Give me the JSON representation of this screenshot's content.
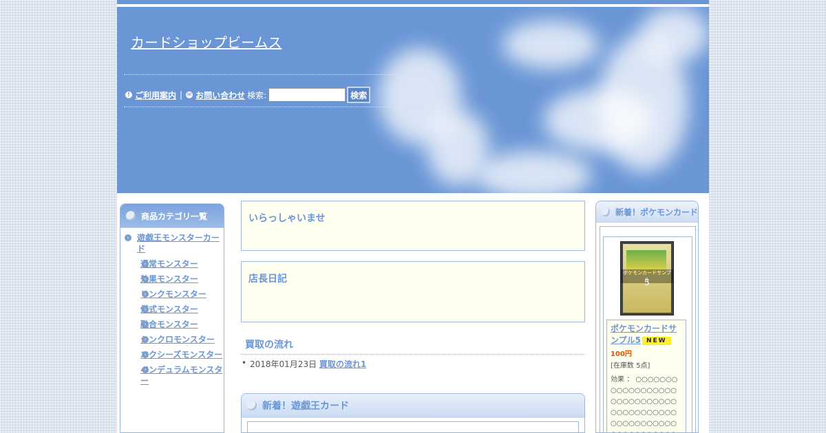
{
  "site_title": "カードショップビームス",
  "nav": {
    "guide_icon": "info-icon",
    "guide_label": "ご利用案内",
    "separator": "|",
    "contact_icon": "mail-icon",
    "contact_label": "お問い合わせ",
    "search_label": "検索:",
    "search_value": "",
    "search_button": "検索"
  },
  "left_sidebar": {
    "title": "商品カテゴリ一覧",
    "categories": [
      {
        "label": "遊戯王モンスターカード",
        "level": 1
      },
      {
        "label": "通常モンスター",
        "level": 2
      },
      {
        "label": "効果モンスター",
        "level": 2
      },
      {
        "label": "リンクモンスター",
        "level": 2
      },
      {
        "label": "儀式モンスター",
        "level": 2
      },
      {
        "label": "融合モンスター",
        "level": 2
      },
      {
        "label": "シンクロモンスター",
        "level": 2
      },
      {
        "label": "エクシーズモンスター",
        "level": 2
      },
      {
        "label": "ペンデュラムモンスター",
        "level": 2
      }
    ]
  },
  "main": {
    "welcome_title": "いらっしゃいませ",
    "diary_title": "店長日記",
    "flow_title": "買取の流れ",
    "flow_date": "2018年01月23日",
    "flow_link": "買取の流れ1",
    "yugioh_title": "新着！遊戯王カード"
  },
  "right_sidebar": {
    "title": "新着！ポケモンカード",
    "product": {
      "image_overlay": "ポケモンカードサンプル",
      "image_number": "5",
      "name": "ポケモンカードサンプル5",
      "badge": "NEW",
      "price": "100円",
      "stock": "[在庫数 5点]",
      "effect": "効果 ： ○○○○○○○○○○○○○○○○○○○○○○○○○○○○○○○○○○○○○○○○○○○○○○○○○○○○○○○○○○○○○○"
    }
  },
  "colors": {
    "accent": "#6a96d6",
    "panel_bg": "#fffff0",
    "price": "#e05000",
    "badge": "#ffee33"
  }
}
